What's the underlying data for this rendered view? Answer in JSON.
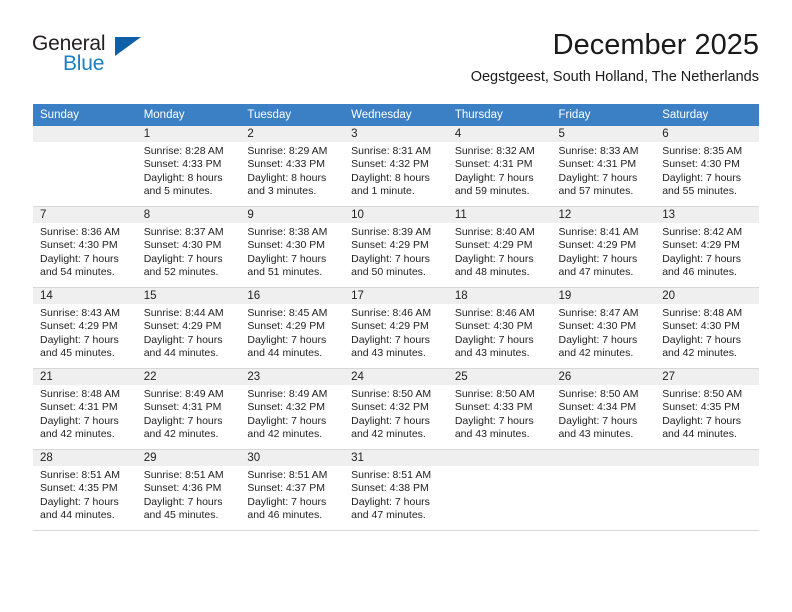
{
  "logo": {
    "text_top": "General",
    "text_bottom": "Blue",
    "triangle_color": "#1060a8",
    "blue_color": "#1c7fc4",
    "icon": "triangle-flag-icon"
  },
  "header": {
    "title": "December 2025",
    "subtitle": "Oegstgeest, South Holland, The Netherlands",
    "accent_color": "#3b7fc4"
  },
  "calendar": {
    "weekday_headers": [
      "Sunday",
      "Monday",
      "Tuesday",
      "Wednesday",
      "Thursday",
      "Friday",
      "Saturday"
    ],
    "header_bg": "#3b7fc4",
    "daynum_bg": "#efefef",
    "weeks": [
      [
        {
          "day": "",
          "sunrise": "",
          "sunset": "",
          "daylight_line1": "",
          "daylight_line2": ""
        },
        {
          "day": "1",
          "sunrise": "Sunrise: 8:28 AM",
          "sunset": "Sunset: 4:33 PM",
          "daylight_line1": "Daylight: 8 hours",
          "daylight_line2": "and 5 minutes."
        },
        {
          "day": "2",
          "sunrise": "Sunrise: 8:29 AM",
          "sunset": "Sunset: 4:33 PM",
          "daylight_line1": "Daylight: 8 hours",
          "daylight_line2": "and 3 minutes."
        },
        {
          "day": "3",
          "sunrise": "Sunrise: 8:31 AM",
          "sunset": "Sunset: 4:32 PM",
          "daylight_line1": "Daylight: 8 hours",
          "daylight_line2": "and 1 minute."
        },
        {
          "day": "4",
          "sunrise": "Sunrise: 8:32 AM",
          "sunset": "Sunset: 4:31 PM",
          "daylight_line1": "Daylight: 7 hours",
          "daylight_line2": "and 59 minutes."
        },
        {
          "day": "5",
          "sunrise": "Sunrise: 8:33 AM",
          "sunset": "Sunset: 4:31 PM",
          "daylight_line1": "Daylight: 7 hours",
          "daylight_line2": "and 57 minutes."
        },
        {
          "day": "6",
          "sunrise": "Sunrise: 8:35 AM",
          "sunset": "Sunset: 4:30 PM",
          "daylight_line1": "Daylight: 7 hours",
          "daylight_line2": "and 55 minutes."
        }
      ],
      [
        {
          "day": "7",
          "sunrise": "Sunrise: 8:36 AM",
          "sunset": "Sunset: 4:30 PM",
          "daylight_line1": "Daylight: 7 hours",
          "daylight_line2": "and 54 minutes."
        },
        {
          "day": "8",
          "sunrise": "Sunrise: 8:37 AM",
          "sunset": "Sunset: 4:30 PM",
          "daylight_line1": "Daylight: 7 hours",
          "daylight_line2": "and 52 minutes."
        },
        {
          "day": "9",
          "sunrise": "Sunrise: 8:38 AM",
          "sunset": "Sunset: 4:30 PM",
          "daylight_line1": "Daylight: 7 hours",
          "daylight_line2": "and 51 minutes."
        },
        {
          "day": "10",
          "sunrise": "Sunrise: 8:39 AM",
          "sunset": "Sunset: 4:29 PM",
          "daylight_line1": "Daylight: 7 hours",
          "daylight_line2": "and 50 minutes."
        },
        {
          "day": "11",
          "sunrise": "Sunrise: 8:40 AM",
          "sunset": "Sunset: 4:29 PM",
          "daylight_line1": "Daylight: 7 hours",
          "daylight_line2": "and 48 minutes."
        },
        {
          "day": "12",
          "sunrise": "Sunrise: 8:41 AM",
          "sunset": "Sunset: 4:29 PM",
          "daylight_line1": "Daylight: 7 hours",
          "daylight_line2": "and 47 minutes."
        },
        {
          "day": "13",
          "sunrise": "Sunrise: 8:42 AM",
          "sunset": "Sunset: 4:29 PM",
          "daylight_line1": "Daylight: 7 hours",
          "daylight_line2": "and 46 minutes."
        }
      ],
      [
        {
          "day": "14",
          "sunrise": "Sunrise: 8:43 AM",
          "sunset": "Sunset: 4:29 PM",
          "daylight_line1": "Daylight: 7 hours",
          "daylight_line2": "and 45 minutes."
        },
        {
          "day": "15",
          "sunrise": "Sunrise: 8:44 AM",
          "sunset": "Sunset: 4:29 PM",
          "daylight_line1": "Daylight: 7 hours",
          "daylight_line2": "and 44 minutes."
        },
        {
          "day": "16",
          "sunrise": "Sunrise: 8:45 AM",
          "sunset": "Sunset: 4:29 PM",
          "daylight_line1": "Daylight: 7 hours",
          "daylight_line2": "and 44 minutes."
        },
        {
          "day": "17",
          "sunrise": "Sunrise: 8:46 AM",
          "sunset": "Sunset: 4:29 PM",
          "daylight_line1": "Daylight: 7 hours",
          "daylight_line2": "and 43 minutes."
        },
        {
          "day": "18",
          "sunrise": "Sunrise: 8:46 AM",
          "sunset": "Sunset: 4:30 PM",
          "daylight_line1": "Daylight: 7 hours",
          "daylight_line2": "and 43 minutes."
        },
        {
          "day": "19",
          "sunrise": "Sunrise: 8:47 AM",
          "sunset": "Sunset: 4:30 PM",
          "daylight_line1": "Daylight: 7 hours",
          "daylight_line2": "and 42 minutes."
        },
        {
          "day": "20",
          "sunrise": "Sunrise: 8:48 AM",
          "sunset": "Sunset: 4:30 PM",
          "daylight_line1": "Daylight: 7 hours",
          "daylight_line2": "and 42 minutes."
        }
      ],
      [
        {
          "day": "21",
          "sunrise": "Sunrise: 8:48 AM",
          "sunset": "Sunset: 4:31 PM",
          "daylight_line1": "Daylight: 7 hours",
          "daylight_line2": "and 42 minutes."
        },
        {
          "day": "22",
          "sunrise": "Sunrise: 8:49 AM",
          "sunset": "Sunset: 4:31 PM",
          "daylight_line1": "Daylight: 7 hours",
          "daylight_line2": "and 42 minutes."
        },
        {
          "day": "23",
          "sunrise": "Sunrise: 8:49 AM",
          "sunset": "Sunset: 4:32 PM",
          "daylight_line1": "Daylight: 7 hours",
          "daylight_line2": "and 42 minutes."
        },
        {
          "day": "24",
          "sunrise": "Sunrise: 8:50 AM",
          "sunset": "Sunset: 4:32 PM",
          "daylight_line1": "Daylight: 7 hours",
          "daylight_line2": "and 42 minutes."
        },
        {
          "day": "25",
          "sunrise": "Sunrise: 8:50 AM",
          "sunset": "Sunset: 4:33 PM",
          "daylight_line1": "Daylight: 7 hours",
          "daylight_line2": "and 43 minutes."
        },
        {
          "day": "26",
          "sunrise": "Sunrise: 8:50 AM",
          "sunset": "Sunset: 4:34 PM",
          "daylight_line1": "Daylight: 7 hours",
          "daylight_line2": "and 43 minutes."
        },
        {
          "day": "27",
          "sunrise": "Sunrise: 8:50 AM",
          "sunset": "Sunset: 4:35 PM",
          "daylight_line1": "Daylight: 7 hours",
          "daylight_line2": "and 44 minutes."
        }
      ],
      [
        {
          "day": "28",
          "sunrise": "Sunrise: 8:51 AM",
          "sunset": "Sunset: 4:35 PM",
          "daylight_line1": "Daylight: 7 hours",
          "daylight_line2": "and 44 minutes."
        },
        {
          "day": "29",
          "sunrise": "Sunrise: 8:51 AM",
          "sunset": "Sunset: 4:36 PM",
          "daylight_line1": "Daylight: 7 hours",
          "daylight_line2": "and 45 minutes."
        },
        {
          "day": "30",
          "sunrise": "Sunrise: 8:51 AM",
          "sunset": "Sunset: 4:37 PM",
          "daylight_line1": "Daylight: 7 hours",
          "daylight_line2": "and 46 minutes."
        },
        {
          "day": "31",
          "sunrise": "Sunrise: 8:51 AM",
          "sunset": "Sunset: 4:38 PM",
          "daylight_line1": "Daylight: 7 hours",
          "daylight_line2": "and 47 minutes."
        },
        {
          "day": "",
          "sunrise": "",
          "sunset": "",
          "daylight_line1": "",
          "daylight_line2": ""
        },
        {
          "day": "",
          "sunrise": "",
          "sunset": "",
          "daylight_line1": "",
          "daylight_line2": ""
        },
        {
          "day": "",
          "sunrise": "",
          "sunset": "",
          "daylight_line1": "",
          "daylight_line2": ""
        }
      ]
    ]
  }
}
